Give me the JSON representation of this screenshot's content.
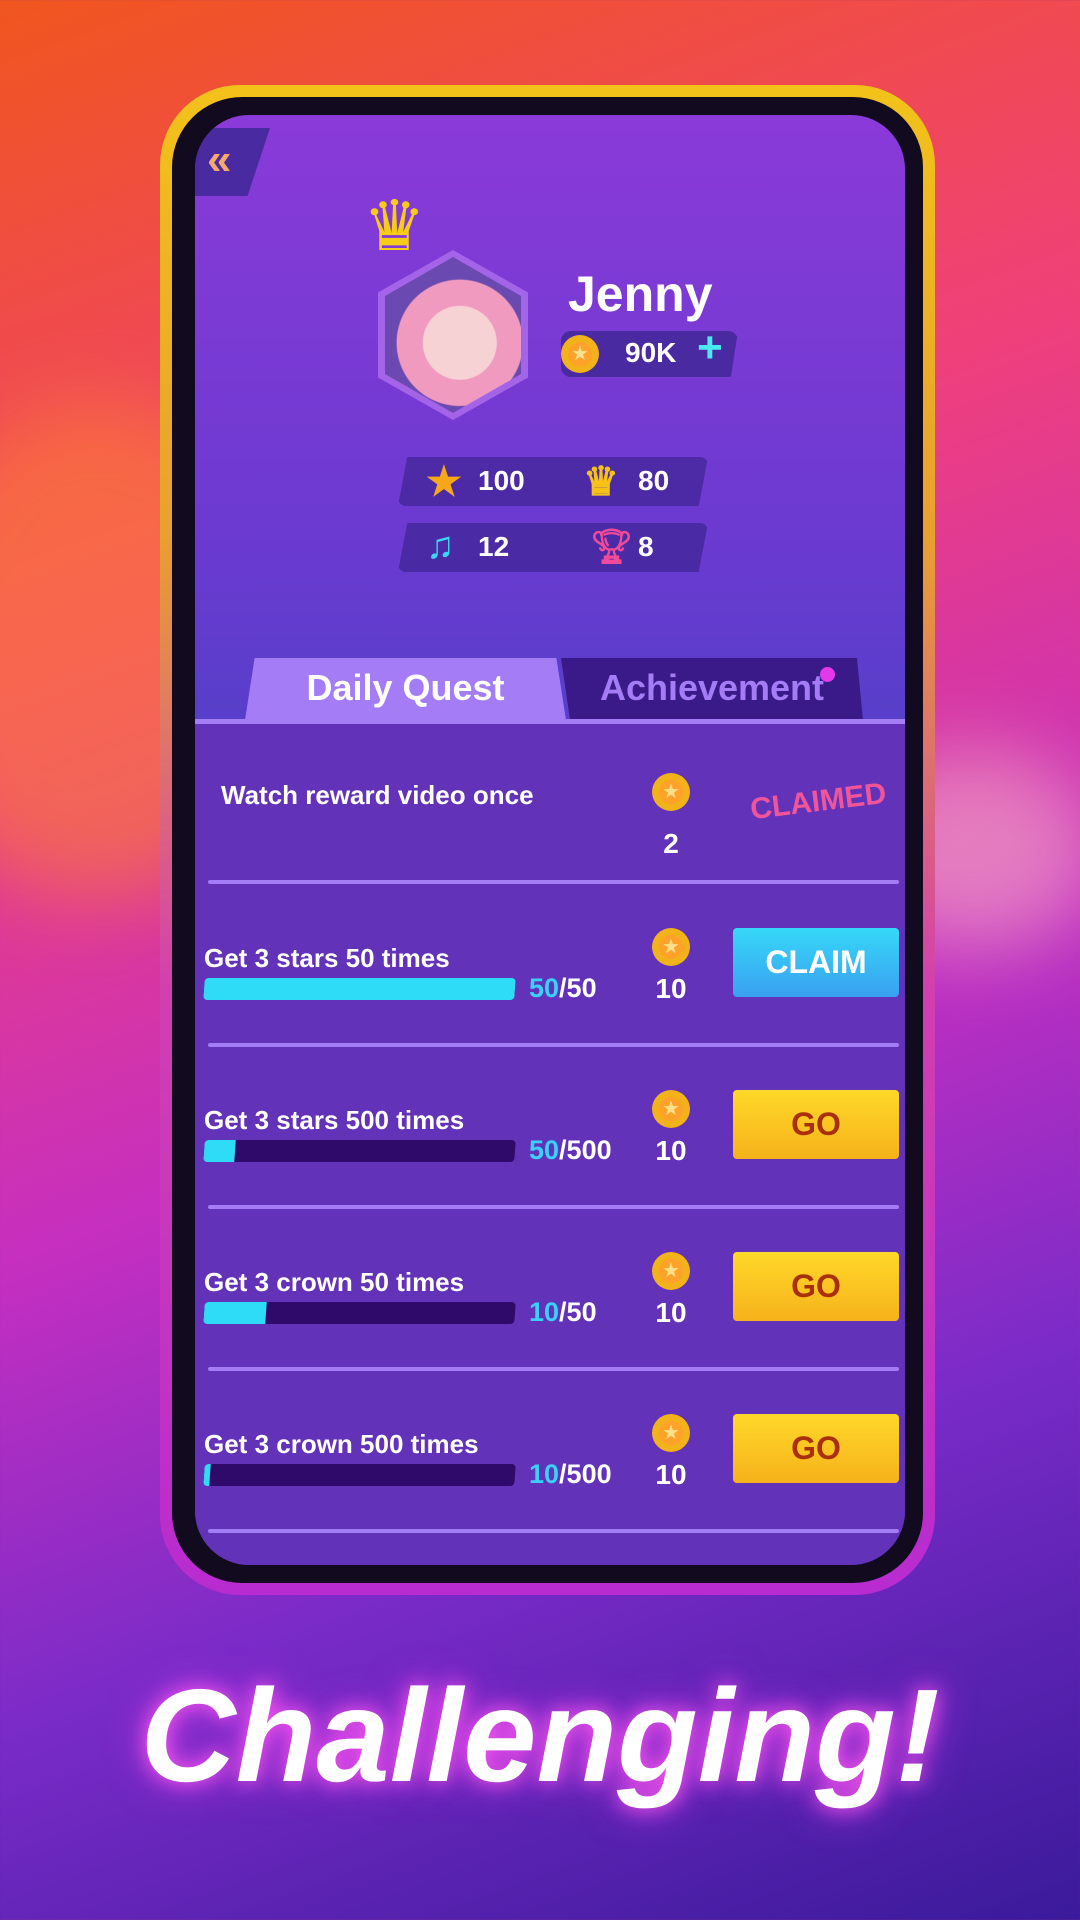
{
  "profile": {
    "name": "Jenny",
    "coins": "90K",
    "add_label": "+"
  },
  "stats": {
    "stars": "100",
    "crowns": "80",
    "songs": "12",
    "trophies": "8"
  },
  "tabs": [
    {
      "label": "Daily Quest",
      "active": true
    },
    {
      "label": "Achievement",
      "has_notification": true
    }
  ],
  "quests": [
    {
      "title": "Watch reward video once",
      "reward": "2",
      "status": "CLAIMED"
    },
    {
      "title": "Get 3 stars 50 times",
      "current": "50",
      "target": "/50",
      "progress": 1.0,
      "reward": "10",
      "button": "CLAIM"
    },
    {
      "title": "Get 3 stars 500 times",
      "current": "50",
      "target": "/500",
      "progress": 0.1,
      "reward": "10",
      "button": "GO"
    },
    {
      "title": "Get 3 crown 50 times",
      "current": "10",
      "target": "/50",
      "progress": 0.2,
      "reward": "10",
      "button": "GO"
    },
    {
      "title": "Get 3 crown 500 times",
      "current": "10",
      "target": "/500",
      "progress": 0.02,
      "reward": "10",
      "button": "GO"
    }
  ],
  "headline": "Challenging!",
  "colors": {
    "progress": "#2fdcf8",
    "claim": "#36c0f6",
    "go": "#f6c21a",
    "claimed": "#f0559a",
    "panel": "#6232b8"
  },
  "icons": {
    "back": "double-chevron-left-icon",
    "coin": "star-coin-icon",
    "stars": "star-icon",
    "crowns": "crown-icon",
    "songs": "music-note-icon",
    "trophies": "trophy-icon"
  }
}
